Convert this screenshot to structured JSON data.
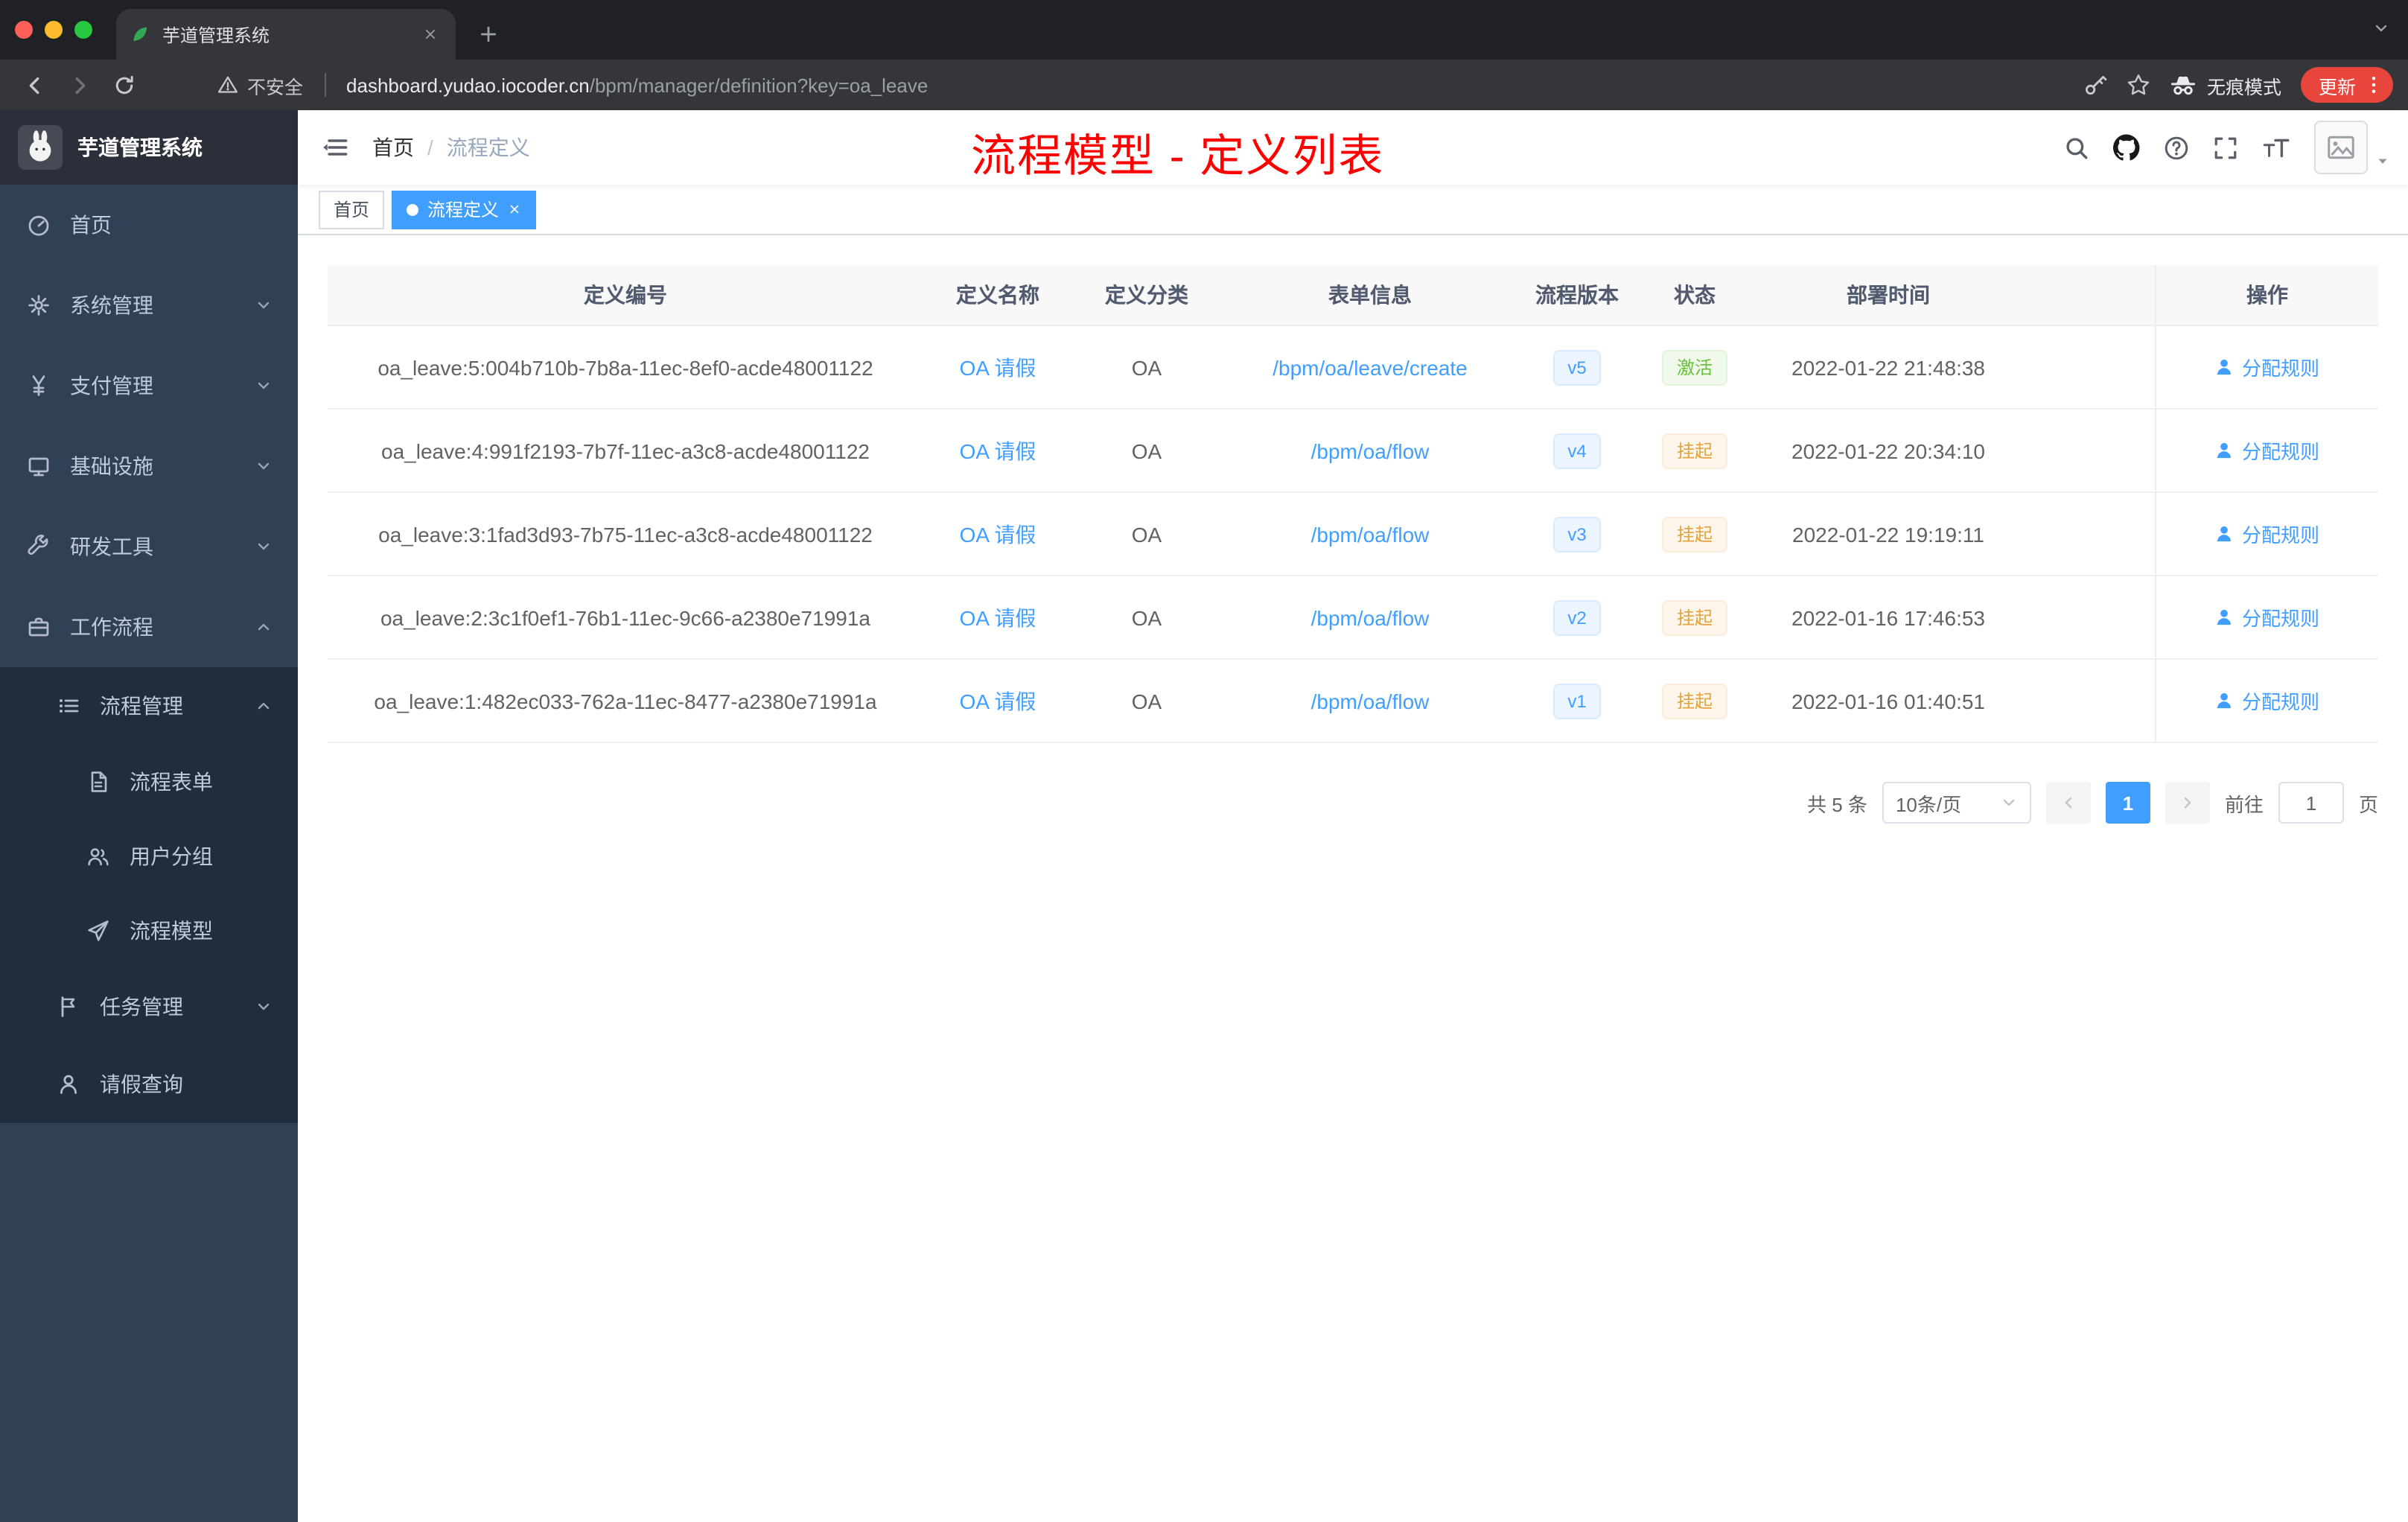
{
  "colors": {
    "accent": "#409EFF",
    "sidebar_bg": "#304156",
    "submenu_bg": "#1F2D3D",
    "success": "#67C23A",
    "warning": "#E6A23C",
    "annotation_red": "#FF0000",
    "chrome_tabstrip": "#202124",
    "chrome_toolbar": "#35363A",
    "update_pill": "#E8453C"
  },
  "browser": {
    "tab_title": "芋道管理系统",
    "security_warning": "不安全",
    "url_host": "dashboard.yudao.iocoder.cn",
    "url_path": "/bpm/manager/definition?key=oa_leave",
    "incognito_label": "无痕模式",
    "update_label": "更新"
  },
  "sidebar": {
    "logo_title": "芋道管理系统",
    "items": [
      {
        "label": "首页",
        "icon": "dashboard-icon",
        "level": 1
      },
      {
        "label": "系统管理",
        "icon": "settings-gear-icon",
        "level": 1,
        "expanded": false
      },
      {
        "label": "支付管理",
        "icon": "yen-icon",
        "level": 1,
        "expanded": false
      },
      {
        "label": "基础设施",
        "icon": "monitor-icon",
        "level": 1,
        "expanded": false
      },
      {
        "label": "研发工具",
        "icon": "tools-icon",
        "level": 1,
        "expanded": false
      },
      {
        "label": "工作流程",
        "icon": "briefcase-icon",
        "level": 1,
        "expanded": true
      },
      {
        "label": "流程管理",
        "icon": "list-icon",
        "level": 2,
        "expanded": true
      },
      {
        "label": "流程表单",
        "icon": "document-icon",
        "level": 3
      },
      {
        "label": "用户分组",
        "icon": "user-group-icon",
        "level": 3
      },
      {
        "label": "流程模型",
        "icon": "send-icon",
        "level": 3
      },
      {
        "label": "任务管理",
        "icon": "flag-icon",
        "level": 2,
        "expanded": false
      },
      {
        "label": "请假查询",
        "icon": "user-icon",
        "level": 2
      }
    ]
  },
  "navbar": {
    "breadcrumb": {
      "home": "首页",
      "separator": "/",
      "current": "流程定义"
    },
    "annotation": "流程模型 - 定义列表"
  },
  "tags": [
    {
      "label": "首页",
      "active": false
    },
    {
      "label": "流程定义",
      "active": true
    }
  ],
  "table": {
    "columns": [
      "定义编号",
      "定义名称",
      "定义分类",
      "表单信息",
      "流程版本",
      "状态",
      "部署时间",
      "操作"
    ],
    "rows": [
      {
        "id": "oa_leave:5:004b710b-7b8a-11ec-8ef0-acde48001122",
        "name": "OA 请假",
        "category": "OA",
        "form": "/bpm/oa/leave/create",
        "version": "v5",
        "status": "激活",
        "status_type": "success",
        "time": "2022-01-22 21:48:38",
        "action": "分配规则"
      },
      {
        "id": "oa_leave:4:991f2193-7b7f-11ec-a3c8-acde48001122",
        "name": "OA 请假",
        "category": "OA",
        "form": "/bpm/oa/flow",
        "version": "v4",
        "status": "挂起",
        "status_type": "warning",
        "time": "2022-01-22 20:34:10",
        "action": "分配规则"
      },
      {
        "id": "oa_leave:3:1fad3d93-7b75-11ec-a3c8-acde48001122",
        "name": "OA 请假",
        "category": "OA",
        "form": "/bpm/oa/flow",
        "version": "v3",
        "status": "挂起",
        "status_type": "warning",
        "time": "2022-01-22 19:19:11",
        "action": "分配规则"
      },
      {
        "id": "oa_leave:2:3c1f0ef1-76b1-11ec-9c66-a2380e71991a",
        "name": "OA 请假",
        "category": "OA",
        "form": "/bpm/oa/flow",
        "version": "v2",
        "status": "挂起",
        "status_type": "warning",
        "time": "2022-01-16 17:46:53",
        "action": "分配规则"
      },
      {
        "id": "oa_leave:1:482ec033-762a-11ec-8477-a2380e71991a",
        "name": "OA 请假",
        "category": "OA",
        "form": "/bpm/oa/flow",
        "version": "v1",
        "status": "挂起",
        "status_type": "warning",
        "time": "2022-01-16 01:40:51",
        "action": "分配规则"
      }
    ]
  },
  "pagination": {
    "total": "共 5 条",
    "page_size": "10条/页",
    "current_page": "1",
    "goto_label": "前往",
    "goto_value": "1",
    "page_unit": "页"
  }
}
